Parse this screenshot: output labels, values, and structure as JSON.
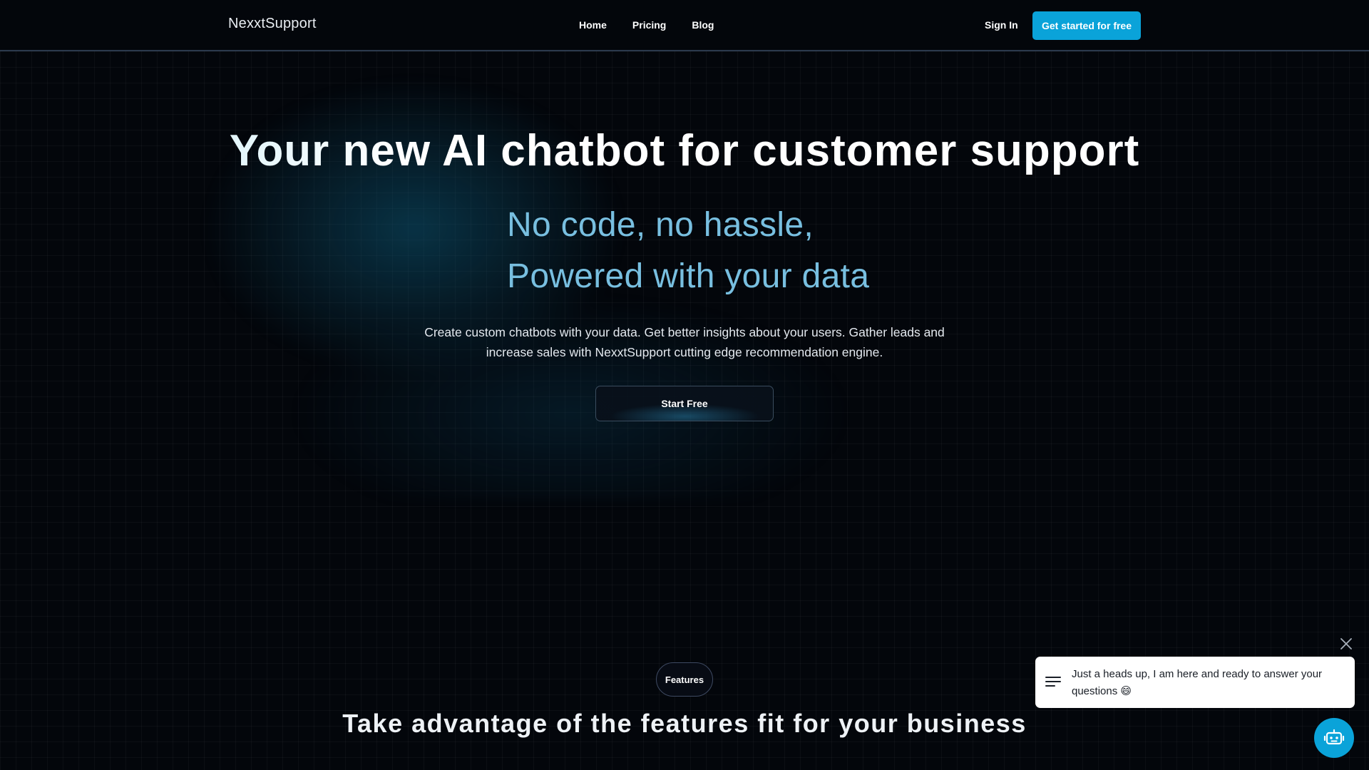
{
  "header": {
    "brand": "NexxtSupport",
    "nav": [
      "Home",
      "Pricing",
      "Blog"
    ],
    "sign_in": "Sign In",
    "cta": "Get started for free"
  },
  "hero": {
    "title": "Your new AI chatbot for customer support",
    "subtitle_line1": "No code, no hassle,",
    "subtitle_line2": "Powered with your data",
    "description": "Create custom chatbots with your data. Get better insights about your users. Gather leads and increase sales with NexxtSupport cutting edge recommendation engine.",
    "start_button": "Start Free"
  },
  "features": {
    "pill": "Features",
    "title": "Take advantage of the features fit for your business"
  },
  "chat_widget": {
    "message": "Just a heads up, I am here and ready to answer your questions 😄",
    "close_icon": "close-icon",
    "menu_icon": "menu-icon",
    "launcher_icon": "robot-icon"
  },
  "colors": {
    "background": "#03060b",
    "accent": "#0aa3d9",
    "subtitle": "#78bfe0"
  }
}
